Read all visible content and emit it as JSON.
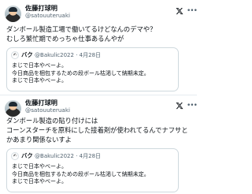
{
  "post1": {
    "display_name": "佐藤打球明",
    "handle": "@satouuteruaki",
    "lines": [
      "ダンボール製造工場で働いてるけどなんのデマや？",
      "むしろ繁忙期でめっちゃ仕事あるんやが"
    ],
    "quote": {
      "name": "バク",
      "handle": "@Bakulic2022",
      "dot": "·",
      "date": "4月28日",
      "lines": [
        "まじで日本やべーよ。",
        "今日商品を梱包するための段ボール枯渇して納期未定。",
        "まじで日本やべーよ。"
      ]
    }
  },
  "post2": {
    "display_name": "佐藤打球明",
    "handle": "@satouuteruaki",
    "lines": [
      "ダンボール製造の貼り付けには",
      "コーンスターチを原料にした接着剤が使われてるんでナフサと",
      "かあまり関係ないすよ"
    ],
    "quote": {
      "name": "バク",
      "handle": "@Bakulic2022",
      "dot": "·",
      "date": "4月28日",
      "lines": [
        "まじで日本やべーよ。",
        "今日商品を梱包するための段ボール枯渇して納期未定。",
        "まじで日本やべーよ。"
      ]
    }
  },
  "icons": {
    "x_logo": "x-logo-icon",
    "more": "more-horizontal-icon"
  }
}
